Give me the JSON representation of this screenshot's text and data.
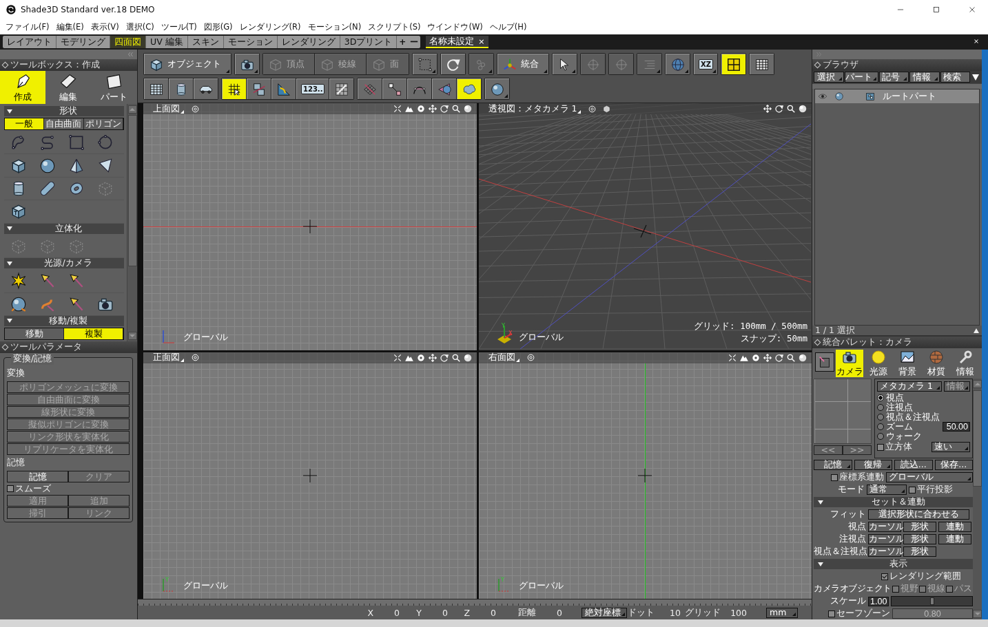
{
  "window": {
    "title": "Shade3D Standard ver.18 DEMO"
  },
  "menu": [
    "ファイル(F)",
    "編集(E)",
    "表示(V)",
    "選択(C)",
    "ツール(T)",
    "図形(G)",
    "レンダリング(R)",
    "モーション(N)",
    "スクリプト(S)",
    "ウインドウ(W)",
    "ヘルプ(H)"
  ],
  "workspace_tabs": [
    {
      "label": "レイアウト",
      "selected": false
    },
    {
      "label": "モデリング",
      "selected": false
    },
    {
      "label": "四面図",
      "selected": true
    },
    {
      "label": "UV 編集",
      "selected": false
    },
    {
      "label": "スキン",
      "selected": false
    },
    {
      "label": "モーション",
      "selected": false
    },
    {
      "label": "レンダリング",
      "selected": false
    },
    {
      "label": "3Dプリント",
      "selected": false
    }
  ],
  "tab_actions": [
    "+",
    "ー"
  ],
  "document_tab": {
    "label": "名称未設定",
    "close": "×"
  },
  "toolbar": [
    [
      [
        {
          "label": "オブジェクト",
          "selected": false,
          "disabled": false,
          "menu": true
        }
      ],
      [
        {
          "selected": false,
          "disabled": false,
          "menu": true
        }
      ],
      [
        {
          "label": "頂点",
          "selected": false,
          "disabled": true,
          "menu": false
        },
        {
          "label": "稜線",
          "selected": false,
          "disabled": true,
          "menu": false
        },
        {
          "label": "面",
          "selected": false,
          "disabled": true,
          "menu": false
        }
      ],
      [
        {
          "selected": false,
          "disabled": false,
          "menu": true
        }
      ],
      [
        {
          "selected": false,
          "disabled": false,
          "menu": false
        }
      ],
      [
        {
          "selected": false,
          "disabled": true,
          "menu": true
        }
      ],
      [
        {
          "label": "統合",
          "selected": false,
          "disabled": false,
          "menu": true
        }
      ],
      [
        {
          "selected": false,
          "disabled": false,
          "menu": true
        }
      ],
      [
        {
          "selected": false,
          "disabled": true,
          "menu": false
        }
      ],
      [
        {
          "selected": false,
          "disabled": true,
          "menu": false
        }
      ],
      [
        {
          "selected": false,
          "disabled": true,
          "menu": true
        }
      ],
      [
        {
          "selected": false,
          "disabled": false,
          "menu": true
        }
      ],
      [
        {
          "label": "XZ",
          "selected": false,
          "disabled": false,
          "menu": true
        }
      ],
      [
        {
          "selected": true,
          "disabled": false,
          "menu": false
        }
      ],
      [
        {
          "selected": false,
          "disabled": false,
          "menu": false
        }
      ]
    ],
    [
      [
        {
          "selected": false,
          "disabled": false,
          "menu": false
        },
        {
          "selected": false,
          "disabled": false,
          "menu": false
        },
        {
          "selected": false,
          "disabled": false,
          "menu": false
        }
      ],
      [
        {
          "selected": true,
          "disabled": false,
          "menu": false
        },
        {
          "selected": false,
          "disabled": false,
          "menu": false
        },
        {
          "selected": false,
          "disabled": false,
          "menu": false
        },
        {
          "label": "123..",
          "selected": false,
          "disabled": false,
          "menu": false
        },
        {
          "selected": false,
          "disabled": false,
          "menu": false
        }
      ],
      [
        {
          "selected": false,
          "disabled": false,
          "menu": false
        },
        {
          "selected": false,
          "disabled": false,
          "menu": false
        },
        {
          "selected": false,
          "disabled": false,
          "menu": false
        },
        {
          "selected": false,
          "disabled": false,
          "menu": false
        },
        {
          "selected": true,
          "disabled": false,
          "menu": false
        }
      ],
      [
        {
          "selected": false,
          "disabled": false,
          "menu": true
        }
      ]
    ]
  ],
  "toolbox": {
    "title": "ツールボックス：作成",
    "modes": [
      {
        "label": "作成",
        "selected": true
      },
      {
        "label": "編集",
        "selected": false
      },
      {
        "label": "パート",
        "selected": false
      }
    ],
    "sections": [
      {
        "title": "形状",
        "expanded": true,
        "tabs": [
          {
            "label": "一般",
            "selected": true
          },
          {
            "label": "自由曲面",
            "selected": false
          },
          {
            "label": "ポリゴン",
            "selected": false
          }
        ],
        "tool_rows": [
          [
            {
              "disabled": false
            },
            {
              "disabled": false
            },
            {
              "disabled": false
            },
            {
              "disabled": false
            }
          ],
          [
            {
              "disabled": false
            },
            {
              "disabled": false
            },
            {
              "disabled": false
            },
            {
              "disabled": false
            }
          ],
          [
            {
              "disabled": false
            },
            {
              "disabled": false
            },
            {
              "disabled": false
            },
            {
              "disabled": true
            }
          ],
          [
            {
              "disabled": false
            }
          ]
        ]
      },
      {
        "title": "立体化",
        "expanded": true,
        "tool_rows": [
          [
            {
              "disabled": true
            },
            {
              "disabled": true
            },
            {
              "disabled": true
            }
          ]
        ]
      },
      {
        "title": "光源/カメラ",
        "expanded": true,
        "tool_rows": [
          [
            {
              "disabled": false
            },
            {
              "disabled": false
            },
            {
              "disabled": false
            }
          ],
          [
            {
              "disabled": false
            },
            {
              "disabled": false
            },
            {
              "disabled": false
            },
            {
              "disabled": false
            }
          ]
        ]
      },
      {
        "title": "移動/複製",
        "expanded": true,
        "tabs": [
          {
            "label": "移動",
            "selected": false
          },
          {
            "label": "複製",
            "selected": true
          }
        ]
      }
    ]
  },
  "tool_parameters": {
    "title": "ツールパラメータ",
    "group": "変換/記憶",
    "sections": [
      {
        "heading": "変換",
        "rows": [
          [
            {
              "kind": "button",
              "label": "ポリゴンメッシュに変換",
              "disabled": true
            }
          ],
          [
            {
              "kind": "button",
              "label": "自由曲面に変換",
              "disabled": true
            }
          ],
          [
            {
              "kind": "button",
              "label": "線形状に変換",
              "disabled": true
            }
          ],
          [
            {
              "kind": "button",
              "label": "擬似ポリゴンに変換",
              "disabled": true
            }
          ],
          [
            {
              "kind": "button",
              "label": "リンク形状を実体化",
              "disabled": true
            }
          ],
          [
            {
              "kind": "button",
              "label": "リプリケータを実体化",
              "disabled": true
            }
          ]
        ]
      },
      {
        "heading": "記憶",
        "rows": [
          [
            {
              "kind": "button",
              "label": "記憶",
              "disabled": false
            },
            {
              "kind": "button",
              "label": "クリア",
              "disabled": true
            }
          ],
          [
            {
              "kind": "checkbox",
              "label": "スムーズ",
              "checked": false
            }
          ],
          [
            {
              "kind": "button",
              "label": "適用",
              "disabled": true
            },
            {
              "kind": "button",
              "label": "追加",
              "disabled": true
            }
          ],
          [
            {
              "kind": "button",
              "label": "掃引",
              "disabled": true
            },
            {
              "kind": "button",
              "label": "リンク",
              "disabled": true
            }
          ]
        ]
      }
    ]
  },
  "viewports": [
    {
      "title": "上面図",
      "kind": "ortho",
      "horizontal_axis_line": true,
      "vertical_axis_line": false,
      "frame_label": "グローバル"
    },
    {
      "title": "透視図：メタカメラ 1",
      "kind": "perspective",
      "frame_label": "グローバル",
      "gizmo": [
        "Y",
        "X"
      ],
      "info": [
        "グリッド: 100mm / 500mm",
        "スナップ: 50mm"
      ]
    },
    {
      "title": "正面図",
      "kind": "ortho",
      "horizontal_axis_line": false,
      "vertical_axis_line": false,
      "frame_label": "グローバル",
      "gizmo": [
        "Y"
      ]
    },
    {
      "title": "右面図",
      "kind": "ortho",
      "horizontal_axis_line": false,
      "vertical_axis_line": true,
      "frame_label": "グローバル",
      "gizmo": [
        "Y"
      ]
    }
  ],
  "status": {
    "fields": [
      {
        "label": "X",
        "value": "0"
      },
      {
        "label": "Y",
        "value": "0"
      },
      {
        "label": "Z",
        "value": "0"
      },
      {
        "label": "距離",
        "value": "0"
      }
    ],
    "coordinate_mode": "絶対座標",
    "grid_fields": [
      {
        "label": "ドット",
        "value": "10"
      },
      {
        "label": "グリッド",
        "value": "100"
      }
    ],
    "unit": "mm"
  },
  "browser": {
    "title": "ブラウザ",
    "tabs": [
      {
        "label": "選択",
        "menu": true
      },
      {
        "label": "パート",
        "menu": true
      },
      {
        "label": "記号",
        "menu": true
      },
      {
        "label": "情報",
        "menu": true
      },
      {
        "label": "検索",
        "menu": false
      }
    ],
    "items": [
      {
        "label": "ルートパート",
        "selected": true
      }
    ],
    "footer": "1 / 1 選択"
  },
  "palette": {
    "title": "統合パレット：カメラ",
    "tabs": [
      {
        "label": "カメラ",
        "selected": true
      },
      {
        "label": "光源",
        "selected": false
      },
      {
        "label": "背景",
        "selected": false
      },
      {
        "label": "材質",
        "selected": false
      },
      {
        "label": "情報",
        "selected": false
      }
    ],
    "camera_select": "メタカメラ 1",
    "info_button": {
      "label": "情報",
      "disabled": true
    },
    "modes": [
      {
        "label": "視点",
        "selected": true
      },
      {
        "label": "注視点",
        "selected": false
      },
      {
        "label": "視点＆注視点",
        "selected": false
      },
      {
        "label": "ズーム",
        "selected": false,
        "value": "50.00"
      },
      {
        "label": "ウォーク",
        "selected": false
      }
    ],
    "cube": {
      "label": "立方体",
      "checked": false
    },
    "speed": "速い",
    "nav": [
      {
        "label": "<<",
        "disabled": true
      },
      {
        "label": ">>",
        "disabled": true
      }
    ],
    "memory": [
      {
        "label": "記憶",
        "menu": true
      },
      {
        "label": "復帰",
        "menu": true
      },
      {
        "label": "読込...",
        "menu": false
      },
      {
        "label": "保存...",
        "menu": false
      }
    ],
    "coordinate_link": {
      "label": "座標系連動",
      "checked": false,
      "value": "グローバル"
    },
    "mode": {
      "label": "モード",
      "value": "通常"
    },
    "parallel": {
      "label": "平行投影",
      "checked": false
    },
    "set_section": {
      "title": "セット＆連動",
      "expanded": true,
      "rows": [
        {
          "label": "フィット",
          "buttons": [
            "選択形状に合わせる"
          ]
        },
        {
          "label": "視点",
          "buttons": [
            "カーソル",
            "形状",
            "連動"
          ]
        },
        {
          "label": "注視点",
          "buttons": [
            "カーソル",
            "形状",
            "連動"
          ]
        },
        {
          "label": "視点＆注視点",
          "buttons": [
            "カーソル",
            "形状"
          ]
        }
      ]
    },
    "display_section": {
      "title": "表示",
      "expanded": true
    },
    "render_range": {
      "label": "レンダリング範囲",
      "checked": true
    },
    "camera_object": {
      "label": "カメラオブジェクト",
      "options": [
        {
          "label": "視野",
          "checked": false,
          "disabled": true
        },
        {
          "label": "視線",
          "checked": false,
          "disabled": true
        },
        {
          "label": "パス",
          "checked": false,
          "disabled": true
        }
      ]
    },
    "scale": {
      "label": "スケール",
      "value": "1.00",
      "level": 0.5
    },
    "safe_zone": {
      "label": "セーフゾーン",
      "checked": false,
      "value": "0.80"
    }
  }
}
